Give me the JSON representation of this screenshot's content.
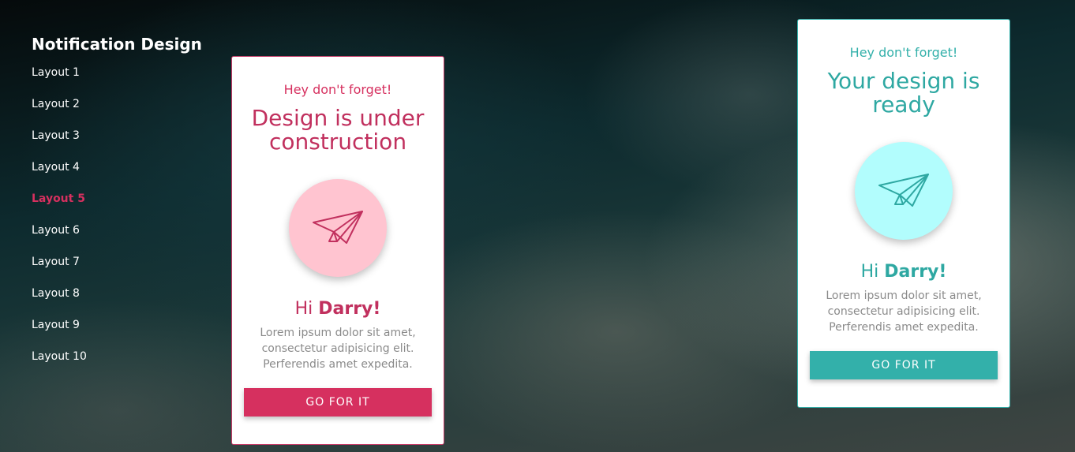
{
  "sidebar": {
    "title": "Notification Design",
    "items": [
      {
        "label": "Layout 1"
      },
      {
        "label": "Layout 2"
      },
      {
        "label": "Layout 3"
      },
      {
        "label": "Layout 4"
      },
      {
        "label": "Layout 5",
        "active": true
      },
      {
        "label": "Layout 6"
      },
      {
        "label": "Layout 7"
      },
      {
        "label": "Layout 8"
      },
      {
        "label": "Layout 9"
      },
      {
        "label": "Layout 10"
      }
    ]
  },
  "cards": {
    "pink": {
      "kicker": "Hey don't forget!",
      "headline": "Design is under construction",
      "icon": "paper-plane-icon",
      "greeting_prefix": "Hi",
      "greeting_name": "Darry!",
      "body": "Lorem ipsum dolor sit amet, consectetur adipisicing elit. Perferendis amet expedita.",
      "cta": "GO FOR IT",
      "accent": "#d6305f",
      "circle_color": "#ffc4d0"
    },
    "teal": {
      "kicker": "Hey don't forget!",
      "headline": "Your design is ready",
      "icon": "paper-plane-icon",
      "greeting_prefix": "Hi",
      "greeting_name": "Darry!",
      "body": "Lorem ipsum dolor sit amet, consectetur adipisicing elit. Perferendis amet expedita.",
      "cta": "GO FOR IT",
      "accent": "#33b0aa",
      "circle_color": "#b2fdfd"
    }
  }
}
